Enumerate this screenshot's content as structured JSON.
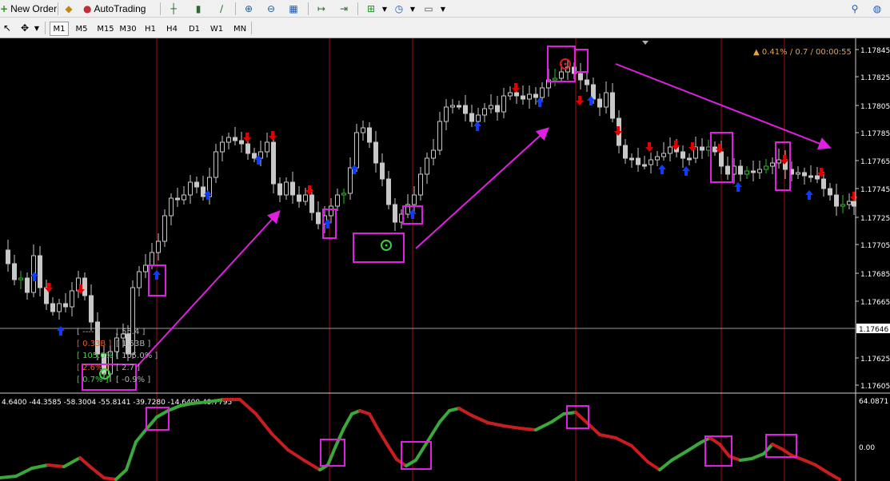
{
  "toolbar": {
    "new_order_label": "New Order",
    "auto_trading_label": "AutoTrading",
    "timeframes": [
      "M1",
      "M5",
      "M15",
      "M30",
      "H1",
      "H4",
      "D1",
      "W1",
      "MN"
    ],
    "active_timeframe": "M1"
  },
  "chart": {
    "status_text": "▲ 0.41% / 0.7 / 00:00:55",
    "price_labels": [
      "1.17845",
      "1.17825",
      "1.17805",
      "1.17785",
      "1.17765",
      "1.17745",
      "1.17725",
      "1.17705",
      "1.17685",
      "1.17665",
      "1.17646",
      "1.17625",
      "1.17605"
    ],
    "current_price": "1.17646",
    "info_panel_left": [
      "[ ---- ]",
      "[ 0.33B ]",
      "[ 105.0% ]",
      "[ 2.6% ]",
      "[ 0.7% ]"
    ],
    "info_panel_right": [
      "[ 55.4 ]",
      "[ 1.53B ]",
      "[ 105.0% ]",
      "[ 2.7 ]",
      "[ -0.9% ]"
    ]
  },
  "indicator": {
    "values_text": "4.6400 -44.3585 -58.3004 -55.8141 -39.7280 -14.6400 49.7795",
    "scale_top": "64.0871",
    "scale_zero": "0.00"
  },
  "colors": {
    "bull_candle": "#c8c8c8",
    "bear_candle": "#c8c8c8",
    "small_bull": "#2db82d",
    "buy_arrow": "#0c3dff",
    "sell_arrow": "#e00000",
    "vline": "#9b1010",
    "highlight": "#e020e0",
    "osc_green": "#3aa83a",
    "osc_red": "#c81e1e",
    "status": "#f0a040"
  }
}
